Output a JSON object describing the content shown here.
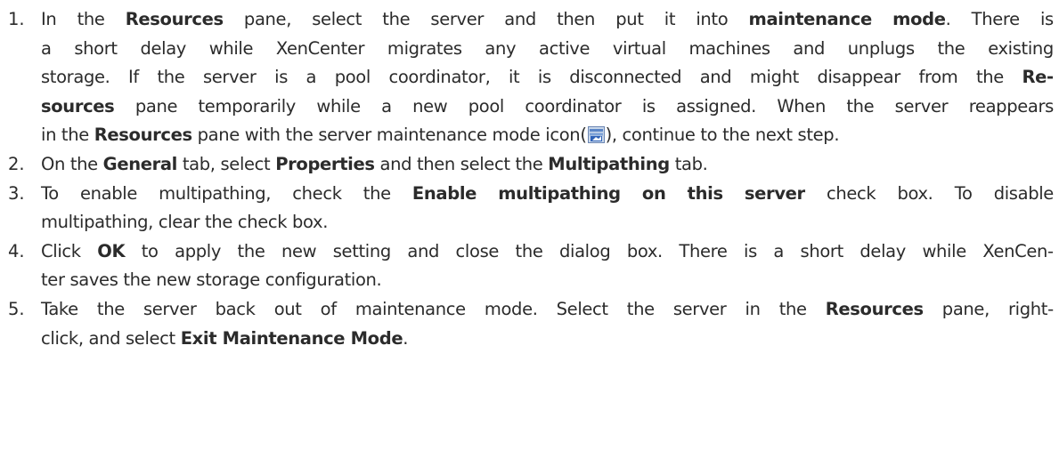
{
  "steps": [
    {
      "number": "1.",
      "lines": [
        [
          "In the ",
          {
            "b": "Resources"
          },
          " pane, select the server and then put it into ",
          {
            "b": "maintenance mode"
          },
          ".  There is"
        ],
        [
          "a short delay while XenCenter migrates any active virtual machines and unplugs the existing"
        ],
        [
          "storage. If the server is a pool coordinator, it is disconnected and might disappear from the ",
          {
            "b": "Re-"
          }
        ],
        [
          {
            "b": "sources"
          },
          " pane temporarily while a new pool coordinator is assigned. When the server reappears"
        ],
        [
          "in the ",
          {
            "b": "Resources"
          },
          " pane with the server maintenance mode icon(",
          {
            "icon": "server-maintenance-mode-icon"
          },
          "), continue to the next step."
        ]
      ]
    },
    {
      "number": "2.",
      "lines": [
        [
          "On the ",
          {
            "b": "General"
          },
          " tab, select ",
          {
            "b": "Properties"
          },
          " and then select the ",
          {
            "b": "Multipathing"
          },
          " tab."
        ]
      ]
    },
    {
      "number": "3.",
      "lines": [
        [
          "To enable multipathing, check the ",
          {
            "b": "Enable multipathing on this server"
          },
          " check box.  To disable"
        ],
        [
          "multipathing, clear the check box."
        ]
      ]
    },
    {
      "number": "4.",
      "lines": [
        [
          "Click ",
          {
            "b": "OK"
          },
          " to apply the new setting and close the dialog box. There is a short delay while XenCen-"
        ],
        [
          "ter saves the new storage configuration."
        ]
      ]
    },
    {
      "number": "5.",
      "lines": [
        [
          "Take the server back out of maintenance mode.  Select the server in the ",
          {
            "b": "Resources"
          },
          " pane, right-"
        ],
        [
          "click, and select ",
          {
            "b": "Exit Maintenance Mode"
          },
          "."
        ]
      ]
    }
  ]
}
